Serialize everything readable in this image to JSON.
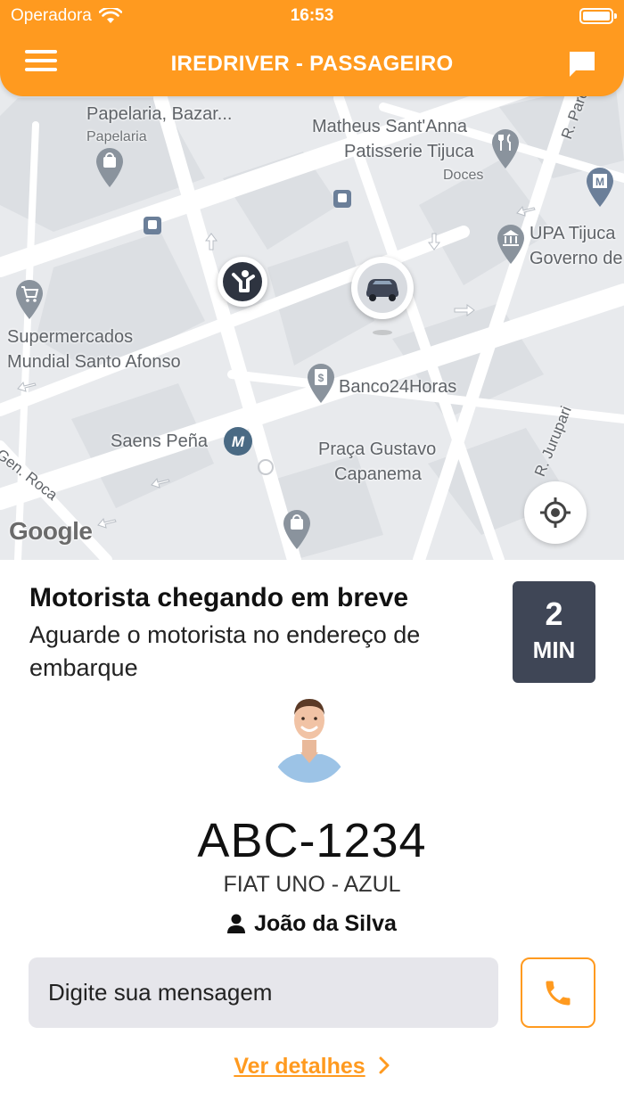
{
  "status_bar": {
    "carrier": "Operadora",
    "time": "16:53"
  },
  "header": {
    "title": "IREDRIVER - PASSAGEIRO",
    "icons": [
      "menu-icon",
      "chat-icon"
    ]
  },
  "map": {
    "places": [
      {
        "name": "Papelaria, Bazar...",
        "category": "Papelaria",
        "icon": "shopping-bag-icon"
      },
      {
        "name": "Matheus Sant'Anna\nPatisserie Tijuca",
        "category": "Doces",
        "icon": "restaurant-icon"
      },
      {
        "name": "UPA Tijuca\nGoverno de",
        "icon": "government-icon"
      },
      {
        "name": "Supermercados\nMundial Santo Afonso",
        "icon": "shopping-cart-icon"
      },
      {
        "name": "Banco24Horas",
        "icon": "bank-icon"
      },
      {
        "name": "Saens Peña",
        "icon": "metro-icon"
      },
      {
        "name": "Praça Gustavo\nCapanema"
      }
    ],
    "streets": [
      "R. Pareto",
      "R. Jurupari",
      "Gen. Roca"
    ],
    "attribution": "Google",
    "markers": [
      "passenger-marker",
      "driver-car-marker"
    ]
  },
  "trip": {
    "status_title": "Motorista chegando em breve",
    "status_description": "Aguarde o motorista no endereço de embarque",
    "eta_value": "2",
    "eta_unit": "MIN"
  },
  "driver": {
    "plate": "ABC-1234",
    "car": "FIAT UNO - AZUL",
    "name": "João da Silva"
  },
  "message": {
    "placeholder": "Digite sua mensagem"
  },
  "actions": {
    "details_label": "Ver detalhes"
  },
  "colors": {
    "accent": "#FF9A1F",
    "eta_box": "#3F4656",
    "input_bg": "#E6E6EB"
  }
}
